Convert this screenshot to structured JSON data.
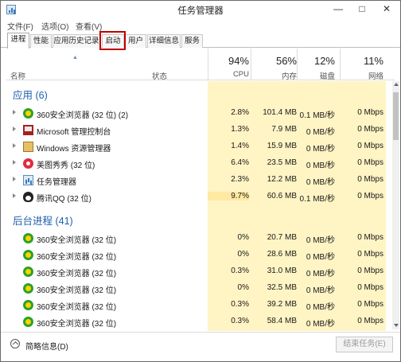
{
  "window": {
    "title": "任务管理器",
    "controls": {
      "minimize": "—",
      "maximize": "□",
      "close": "✕"
    }
  },
  "menu": [
    "文件(F)",
    "选项(O)",
    "查看(V)"
  ],
  "tabs": [
    "进程",
    "性能",
    "应用历史记录",
    "启动",
    "用户",
    "详细信息",
    "服务"
  ],
  "active_tab": "进程",
  "highlighted_tab": "启动",
  "columns": {
    "name": "名称",
    "status": "状态",
    "cpu": {
      "pct": "94%",
      "label": "CPU"
    },
    "memory": {
      "pct": "56%",
      "label": "内存"
    },
    "disk": {
      "pct": "12%",
      "label": "磁盘"
    },
    "network": {
      "pct": "11%",
      "label": "网络"
    }
  },
  "groups": {
    "apps": "应用 (6)",
    "background": "后台进程 (41)"
  },
  "apps": [
    {
      "name": "360安全浏览器 (32 位) (2)",
      "icon": "browser-360-icon",
      "cpu": "2.8%",
      "memory": "101.4 MB",
      "disk": "0.1 MB/秒",
      "network": "0 Mbps"
    },
    {
      "name": "Microsoft 管理控制台",
      "icon": "mmc-icon",
      "cpu": "1.3%",
      "memory": "7.9 MB",
      "disk": "0 MB/秒",
      "network": "0 Mbps"
    },
    {
      "name": "Windows 资源管理器",
      "icon": "explorer-icon",
      "cpu": "1.4%",
      "memory": "15.9 MB",
      "disk": "0 MB/秒",
      "network": "0 Mbps"
    },
    {
      "name": "美图秀秀 (32 位)",
      "icon": "meitu-icon",
      "cpu": "6.4%",
      "memory": "23.5 MB",
      "disk": "0 MB/秒",
      "network": "0 Mbps"
    },
    {
      "name": "任务管理器",
      "icon": "task-manager-icon",
      "cpu": "2.3%",
      "memory": "12.2 MB",
      "disk": "0 MB/秒",
      "network": "0 Mbps"
    },
    {
      "name": "腾讯QQ (32 位)",
      "icon": "qq-icon",
      "cpu": "9.7%",
      "memory": "60.6 MB",
      "disk": "0.1 MB/秒",
      "network": "0 Mbps"
    }
  ],
  "background": [
    {
      "name": "360安全浏览器 (32 位)",
      "icon": "browser-360-icon",
      "cpu": "0%",
      "memory": "20.7 MB",
      "disk": "0 MB/秒",
      "network": "0 Mbps"
    },
    {
      "name": "360安全浏览器 (32 位)",
      "icon": "browser-360-icon",
      "cpu": "0%",
      "memory": "28.6 MB",
      "disk": "0 MB/秒",
      "network": "0 Mbps"
    },
    {
      "name": "360安全浏览器 (32 位)",
      "icon": "browser-360-icon",
      "cpu": "0.3%",
      "memory": "31.0 MB",
      "disk": "0 MB/秒",
      "network": "0 Mbps"
    },
    {
      "name": "360安全浏览器 (32 位)",
      "icon": "browser-360-icon",
      "cpu": "0%",
      "memory": "32.5 MB",
      "disk": "0 MB/秒",
      "network": "0 Mbps"
    },
    {
      "name": "360安全浏览器 (32 位)",
      "icon": "browser-360-icon",
      "cpu": "0.3%",
      "memory": "39.2 MB",
      "disk": "0 MB/秒",
      "network": "0 Mbps"
    },
    {
      "name": "360安全浏览器 (32 位)",
      "icon": "browser-360-icon",
      "cpu": "0.3%",
      "memory": "58.4 MB",
      "disk": "0 MB/秒",
      "network": "0 Mbps"
    }
  ],
  "footer": {
    "fewer_details": "简略信息(D)",
    "end_task": "结束任务(E)"
  },
  "colors": {
    "heat_light": "#fff4c4",
    "heat_medium": "#ffe9a3",
    "group_title": "#1f5fae",
    "highlight": "#c00000"
  }
}
